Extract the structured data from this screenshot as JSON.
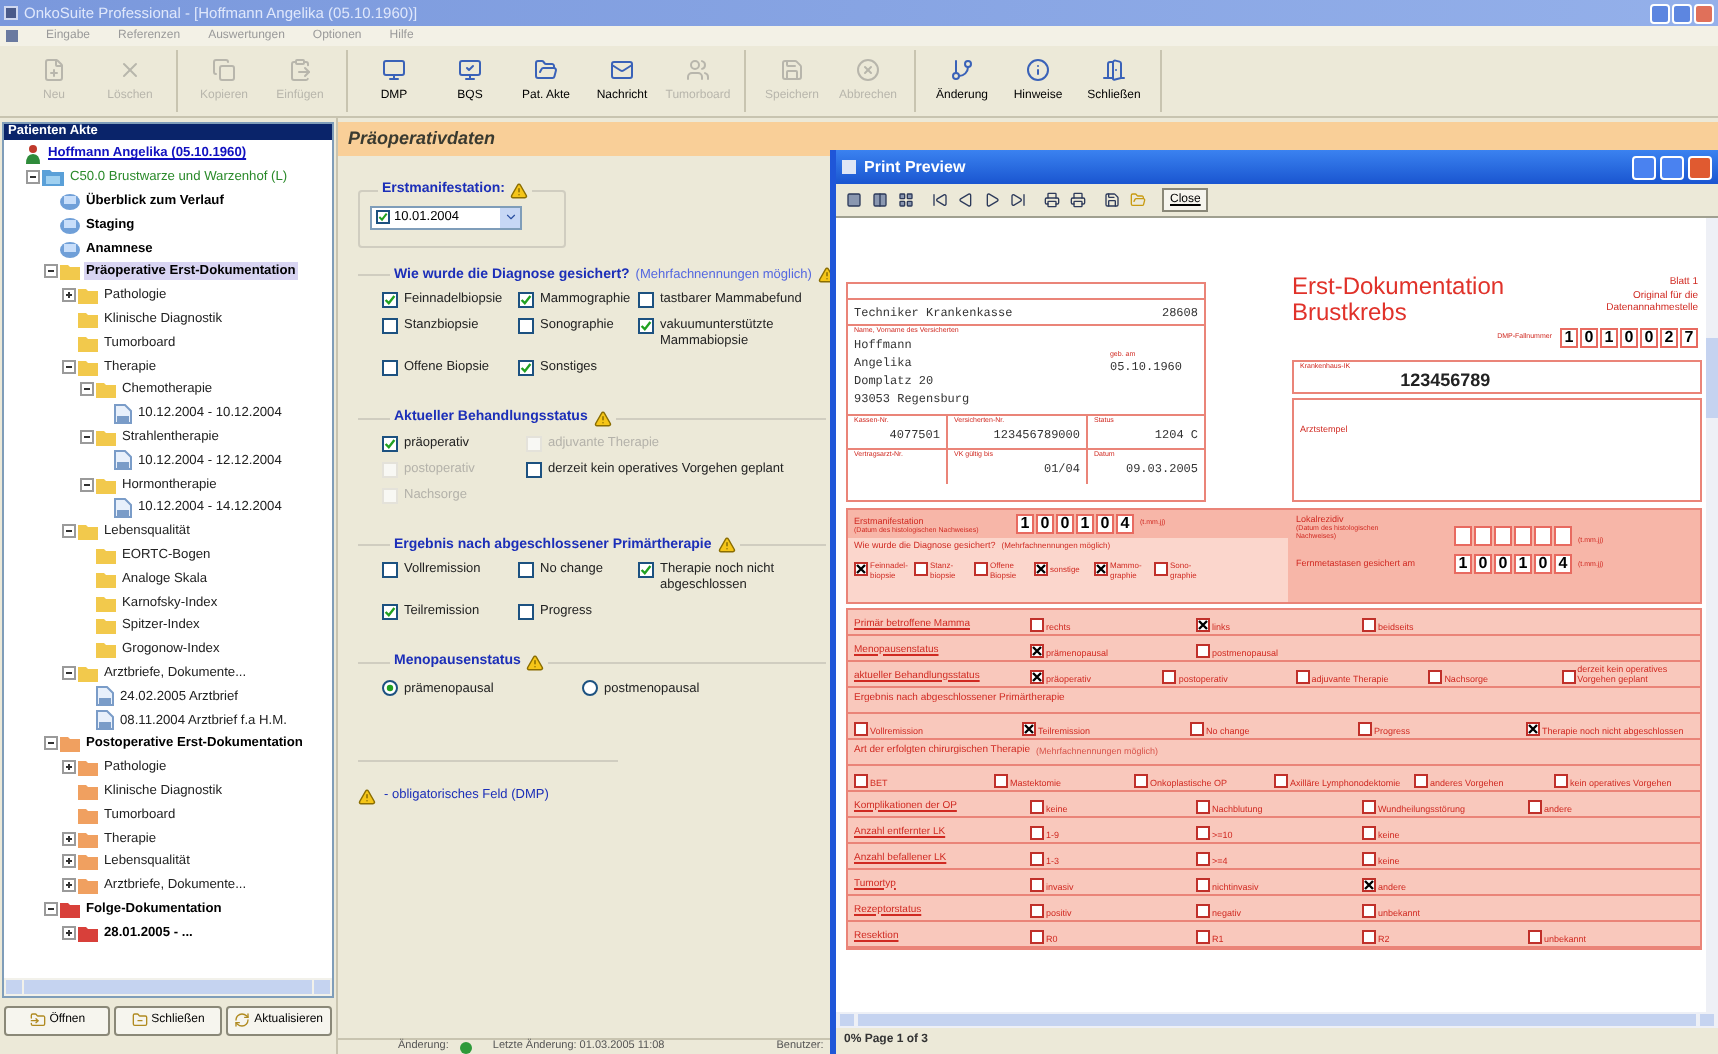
{
  "window": {
    "title": "OnkoSuite Professional - [Hoffmann Angelika  (05.10.1960)]"
  },
  "menu": [
    "Eingabe",
    "Referenzen",
    "Auswertungen",
    "Optionen",
    "Hilfe"
  ],
  "toolbar": [
    {
      "label": "Neu",
      "disabled": true
    },
    {
      "label": "Löschen",
      "disabled": true
    },
    {
      "label": "Kopieren",
      "disabled": true
    },
    {
      "label": "Einfügen",
      "disabled": true
    },
    {
      "label": "DMP",
      "disabled": false
    },
    {
      "label": "BQS",
      "disabled": false
    },
    {
      "label": "Pat. Akte",
      "disabled": false
    },
    {
      "label": "Nachricht",
      "disabled": false
    },
    {
      "label": "Tumorboard",
      "disabled": true
    },
    {
      "label": "Speichern",
      "disabled": true
    },
    {
      "label": "Abbrechen",
      "disabled": true
    },
    {
      "label": "Änderung",
      "disabled": false
    },
    {
      "label": "Hinweise",
      "disabled": false
    },
    {
      "label": "Schließen",
      "disabled": false
    }
  ],
  "sidebar": {
    "title": "Patienten Akte",
    "tree": [
      {
        "label": "Hoffmann Angelika  (05.10.1960)",
        "kind": "patient",
        "selected": false,
        "children": [
          {
            "label": "C50.0 Brustwarze und Warzenhof (L)",
            "kind": "diagnosis",
            "expanded": true,
            "selected": false,
            "children": [
              {
                "label": "Überblick zum Verlauf",
                "kind": "section",
                "selected": false
              },
              {
                "label": "Staging",
                "kind": "section",
                "selected": false
              },
              {
                "label": "Anamnese",
                "kind": "section",
                "selected": false
              },
              {
                "label": "Präoperative Erst-Dokumentation",
                "kind": "group",
                "color": "#f2c94c",
                "expanded": true,
                "selected": true,
                "children": [
                  {
                    "label": "Pathologie",
                    "kind": "folder",
                    "color": "#f2c94c",
                    "expanded": false,
                    "selected": false
                  },
                  {
                    "label": "Klinische Diagnostik",
                    "kind": "folder",
                    "color": "#f2c94c",
                    "selected": false
                  },
                  {
                    "label": "Tumorboard",
                    "kind": "folder",
                    "color": "#f2c94c",
                    "selected": false
                  },
                  {
                    "label": "Therapie",
                    "kind": "folder",
                    "color": "#f2c94c",
                    "expanded": true,
                    "selected": false,
                    "children": [
                      {
                        "label": "Chemotherapie",
                        "kind": "folder",
                        "color": "#f2c94c",
                        "expanded": true,
                        "selected": false,
                        "children": [
                          {
                            "label": "10.12.2004 - 10.12.2004",
                            "kind": "record",
                            "selected": false
                          }
                        ]
                      },
                      {
                        "label": "Strahlentherapie",
                        "kind": "folder",
                        "color": "#f2c94c",
                        "expanded": true,
                        "selected": false,
                        "children": [
                          {
                            "label": "10.12.2004 - 12.12.2004",
                            "kind": "record",
                            "selected": false
                          }
                        ]
                      },
                      {
                        "label": "Hormontherapie",
                        "kind": "folder",
                        "color": "#f2c94c",
                        "expanded": true,
                        "selected": false,
                        "children": [
                          {
                            "label": "10.12.2004 - 14.12.2004",
                            "kind": "record",
                            "selected": false
                          }
                        ]
                      }
                    ]
                  },
                  {
                    "label": "Lebensqualität",
                    "kind": "folder",
                    "color": "#f2c94c",
                    "expanded": true,
                    "selected": false,
                    "children": [
                      {
                        "label": "EORTC-Bogen",
                        "kind": "folder",
                        "color": "#f2c94c",
                        "selected": false
                      },
                      {
                        "label": "Analoge Skala",
                        "kind": "folder",
                        "color": "#f2c94c",
                        "selected": false
                      },
                      {
                        "label": "Karnofsky-Index",
                        "kind": "folder",
                        "color": "#f2c94c",
                        "selected": false
                      },
                      {
                        "label": "Spitzer-Index",
                        "kind": "folder",
                        "color": "#f2c94c",
                        "selected": false
                      },
                      {
                        "label": "Grogonow-Index",
                        "kind": "folder",
                        "color": "#f2c94c",
                        "selected": false
                      }
                    ]
                  },
                  {
                    "label": "Arztbriefe, Dokumente...",
                    "kind": "folder",
                    "color": "#f2c94c",
                    "expanded": true,
                    "selected": false,
                    "children": [
                      {
                        "label": "24.02.2005 Arztbrief",
                        "kind": "record",
                        "selected": false
                      },
                      {
                        "label": "08.11.2004 Arztbrief f.a H.M.",
                        "kind": "record",
                        "selected": false
                      }
                    ]
                  }
                ]
              },
              {
                "label": "Postoperative Erst-Dokumentation",
                "kind": "group",
                "color": "#f0a060",
                "expanded": true,
                "selected": false,
                "children": [
                  {
                    "label": "Pathologie",
                    "kind": "folder",
                    "color": "#f0a060",
                    "expanded": false,
                    "selected": false
                  },
                  {
                    "label": "Klinische Diagnostik",
                    "kind": "folder",
                    "color": "#f0a060",
                    "selected": false
                  },
                  {
                    "label": "Tumorboard",
                    "kind": "folder",
                    "color": "#f0a060",
                    "selected": false
                  },
                  {
                    "label": "Therapie",
                    "kind": "folder",
                    "color": "#f0a060",
                    "expanded": false,
                    "selected": false
                  },
                  {
                    "label": "Lebensqualität",
                    "kind": "folder",
                    "color": "#f0a060",
                    "expanded": false,
                    "selected": false
                  },
                  {
                    "label": "Arztbriefe, Dokumente...",
                    "kind": "folder",
                    "color": "#f0a060",
                    "expanded": false,
                    "selected": false
                  }
                ]
              },
              {
                "label": "Folge-Dokumentation",
                "kind": "group",
                "color": "#d8403a",
                "expanded": true,
                "selected": false,
                "children": [
                  {
                    "label": "28.01.2005 - ...",
                    "kind": "episode",
                    "color": "#d8403a",
                    "expanded": false,
                    "selected": false
                  }
                ]
              }
            ]
          }
        ]
      }
    ],
    "buttons": [
      "Öffnen",
      "Schließen",
      "Aktualisieren"
    ]
  },
  "form": {
    "title": "Präoperativdaten",
    "groups": [
      {
        "kind": "date",
        "title": "Erstmanifestation:",
        "value": "10.01.2004",
        "checked": true
      },
      {
        "kind": "checks",
        "title": "Wie wurde die Diagnose gesichert?",
        "note": "(Mehrfachnennungen möglich)",
        "rows": [
          [
            {
              "label": "Feinnadelbiopsie",
              "checked": true,
              "disabled": false
            },
            {
              "label": "Mammographie",
              "checked": true,
              "disabled": false
            },
            {
              "label": "tastbarer Mammabefund",
              "checked": false,
              "disabled": false
            }
          ],
          [
            {
              "label": "Stanzbiopsie",
              "checked": false,
              "disabled": false
            },
            {
              "label": "Sonographie",
              "checked": false,
              "disabled": false
            },
            {
              "label": "vakuumunterstützte Mammabiopsie",
              "checked": true,
              "disabled": false
            }
          ],
          [
            {
              "label": "Offene Biopsie",
              "checked": false,
              "disabled": false
            },
            {
              "label": "Sonstiges",
              "checked": true,
              "disabled": false
            }
          ]
        ]
      },
      {
        "kind": "checks",
        "title": "Aktueller Behandlungsstatus",
        "rows": [
          [
            {
              "label": "präoperativ",
              "checked": true,
              "disabled": false
            },
            {
              "label": "adjuvante Therapie",
              "checked": false,
              "disabled": true
            }
          ],
          [
            {
              "label": "postoperativ",
              "checked": false,
              "disabled": true
            },
            {
              "label": "derzeit kein operatives Vorgehen geplant",
              "checked": false,
              "disabled": false
            }
          ],
          [
            {
              "label": "Nachsorge",
              "checked": false,
              "disabled": true
            }
          ]
        ]
      },
      {
        "kind": "checks",
        "title": "Ergebnis nach abgeschlossener Primärtherapie",
        "rows": [
          [
            {
              "label": "Vollremission",
              "checked": false,
              "disabled": false
            },
            {
              "label": "No change",
              "checked": false,
              "disabled": false
            },
            {
              "label": "Therapie noch nicht abgeschlossen",
              "checked": true,
              "disabled": false
            }
          ],
          [
            {
              "label": "Teilremission",
              "checked": true,
              "disabled": false
            },
            {
              "label": "Progress",
              "checked": false,
              "disabled": false
            }
          ]
        ]
      },
      {
        "kind": "radio",
        "title": "Menopausenstatus",
        "options": [
          {
            "label": "prämenopausal",
            "selected": true
          },
          {
            "label": "postmenopausal",
            "selected": false
          }
        ]
      }
    ],
    "legend": "- obligatorisches Feld (DMP)"
  },
  "status_bar": [
    "Änderung:",
    "Letzte Änderung: 01.03.2005 11:08",
    "Benutzer:"
  ],
  "preview": {
    "title": "Print Preview",
    "close_label": "Close",
    "status": "0% Page 1 of 3",
    "page": {
      "insurer": "Techniker Krankenkasse",
      "insurer_number": "28608",
      "name_label": "Name, Vorname des Versicherten",
      "address": [
        "Hoffmann",
        "Angelika",
        "Domplatz 20",
        "93053 Regensburg"
      ],
      "birth_label": "geb. am",
      "birth": "05.10.1960",
      "fields": [
        [
          {
            "label": "Kassen-Nr.",
            "value": "4077501"
          },
          {
            "label": "Versicherten-Nr.",
            "value": "123456789000"
          },
          {
            "label": "Status",
            "value": "1204 C"
          }
        ],
        [
          {
            "label": "Vertragsarzt-Nr."
          },
          {
            "label": "VK gültig bis",
            "value": "01/04"
          },
          {
            "label": "Datum",
            "value": "09.03.2005"
          }
        ]
      ],
      "title": [
        "Erst-Dokumentation",
        "Brustkrebs"
      ],
      "sheet": "Blatt 1",
      "copy_note": "Original für die Datenannahmestelle",
      "case_label": "DMP-Fallnummer",
      "case_digits": [
        "1",
        "0",
        "1",
        "0",
        "0",
        "2",
        "7"
      ],
      "hospital_label": "Krankenhaus-IK",
      "hospital_id": "123456789",
      "stamp_label": "Arztstempel",
      "first_label": "Erstmanifestation",
      "first_sub": "(Datum des histologischen Nachweises)",
      "first_digits": [
        "1",
        "0",
        "0",
        "1",
        "0",
        "4"
      ],
      "first_format": "(t.mm.jj)",
      "question": "Wie wurde die Diagnose gesichert?",
      "question_note": "(Mehrfachnennungen möglich)",
      "methods": [
        {
          "label": "Feinnadel- biopsie",
          "checked": true
        },
        {
          "label": "Stanz- biopsie",
          "checked": false
        },
        {
          "label": "Offene Biopsie",
          "checked": false
        },
        {
          "label": "sonstige",
          "checked": true
        },
        {
          "label": "Mammo- graphie",
          "checked": true
        },
        {
          "label": "Sono- graphie",
          "checked": false
        }
      ],
      "relapse_label": "Lokalrezidiv",
      "relapse_sub": "(Datum des histologischen Nachweises)",
      "relapse_format": "(t.mm.jj)",
      "metastasis_label": "Fernmetastasen gesichert am",
      "metastasis_digits": [
        "1",
        "0",
        "0",
        "1",
        "0",
        "4"
      ],
      "metastasis_format": "(t.mm.jj)",
      "rows": [
        {
          "kind": "options",
          "label": "Primär betroffene Mamma",
          "options": [
            {
              "label": "rechts",
              "checked": false
            },
            {
              "label": "links",
              "checked": true
            },
            {
              "label": "beidseits",
              "checked": false
            }
          ]
        },
        {
          "kind": "options",
          "label": "Menopausenstatus",
          "options": [
            {
              "label": "prämenopausal",
              "checked": true
            },
            {
              "label": "postmenopausal",
              "checked": false
            }
          ]
        },
        {
          "kind": "options",
          "label": "aktueller Behandlungsstatus",
          "options": [
            {
              "label": "präoperativ",
              "checked": true
            },
            {
              "label": "postoperativ",
              "checked": false
            },
            {
              "label": "adjuvante Therapie",
              "checked": false
            },
            {
              "label": "Nachsorge",
              "checked": false
            },
            {
              "label": "derzeit kein operatives Vorgehen geplant",
              "checked": false
            }
          ]
        },
        {
          "kind": "heading",
          "label": "Ergebnis nach abgeschlossener Primärtherapie"
        },
        {
          "kind": "options",
          "options": [
            {
              "label": "Vollremission",
              "checked": false
            },
            {
              "label": "Teilremission",
              "checked": true
            },
            {
              "label": "No change",
              "checked": false
            },
            {
              "label": "Progress",
              "checked": false
            },
            {
              "label": "Therapie noch nicht abgeschlossen",
              "checked": true
            }
          ]
        },
        {
          "kind": "heading",
          "label": "Art der erfolgten chirurgischen Therapie",
          "note": "(Mehrfachnennungen möglich)"
        },
        {
          "kind": "options",
          "options": [
            {
              "label": "BET",
              "checked": false
            },
            {
              "label": "Mastektomie",
              "checked": false
            },
            {
              "label": "Onkoplastische OP",
              "checked": false
            },
            {
              "label": "Axilläre Lymphonodektomie",
              "checked": false
            },
            {
              "label": "anderes Vorgehen",
              "checked": false
            },
            {
              "label": "kein operatives Vorgehen",
              "checked": false
            }
          ]
        },
        {
          "kind": "options",
          "label": "Komplikationen der OP",
          "options": [
            {
              "label": "keine",
              "checked": false
            },
            {
              "label": "Nachblutung",
              "checked": false
            },
            {
              "label": "Wundheilungsstörung",
              "checked": false
            },
            {
              "label": "andere",
              "checked": false
            }
          ]
        },
        {
          "kind": "options",
          "label": "Anzahl entfernter LK",
          "options": [
            {
              "label": "1-9",
              "checked": false
            },
            {
              "label": ">=10",
              "checked": false
            },
            {
              "label": "keine",
              "checked": false
            }
          ]
        },
        {
          "kind": "options",
          "label": "Anzahl befallener LK",
          "options": [
            {
              "label": "1-3",
              "checked": false
            },
            {
              "label": ">=4",
              "checked": false
            },
            {
              "label": "keine",
              "checked": false
            }
          ]
        },
        {
          "kind": "options",
          "label": "Tumortyp",
          "options": [
            {
              "label": "invasiv",
              "checked": false
            },
            {
              "label": "nichtinvasiv",
              "checked": false
            },
            {
              "label": "andere",
              "checked": true
            }
          ]
        },
        {
          "kind": "options",
          "label": "Rezeptorstatus",
          "options": [
            {
              "label": "positiv",
              "checked": false
            },
            {
              "label": "negativ",
              "checked": false
            },
            {
              "label": "unbekannt",
              "checked": false
            }
          ]
        },
        {
          "kind": "options",
          "label": "Resektion",
          "options": [
            {
              "label": "R0",
              "checked": false
            },
            {
              "label": "R1",
              "checked": false
            },
            {
              "label": "R2",
              "checked": false
            },
            {
              "label": "unbekannt",
              "checked": false
            }
          ]
        }
      ]
    }
  }
}
